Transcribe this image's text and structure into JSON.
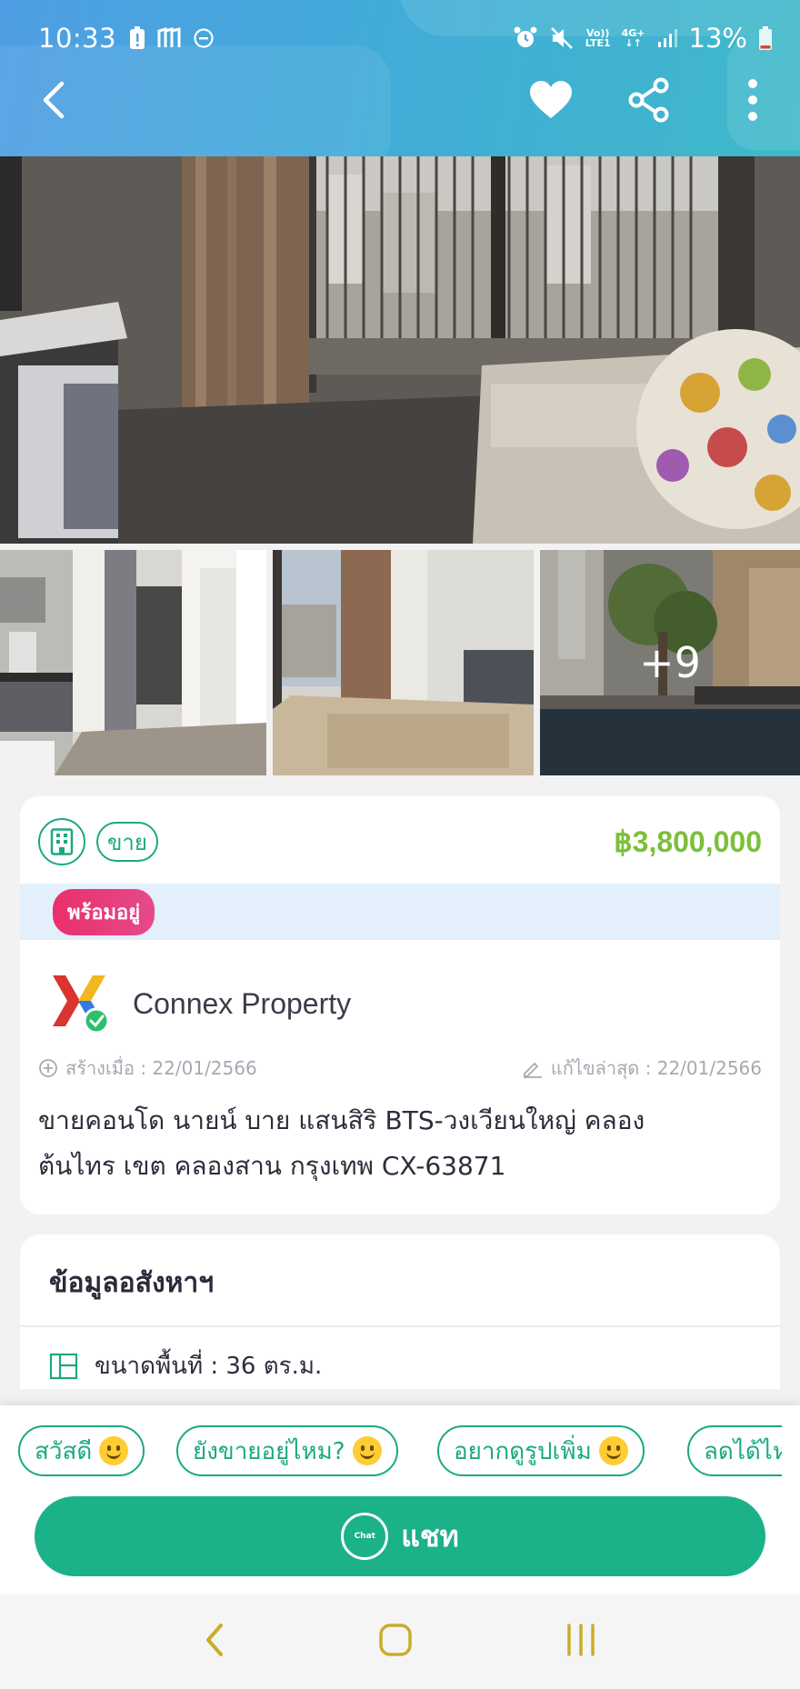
{
  "status_bar": {
    "time": "10:33",
    "net_top": "Vo))",
    "net_bottom": "LTE1",
    "net2_top": "4G+",
    "battery": "13%"
  },
  "gallery": {
    "more_count": "+9"
  },
  "listing": {
    "type_badge": "ขาย",
    "price": "฿3,800,000",
    "status_pill": "พร้อมอยู่",
    "agent_name": "Connex Property",
    "created_label": "สร้างเมื่อ : 22/01/2566",
    "updated_label": "แก้ไขล่าสุด : 22/01/2566",
    "title_line1": "ขายคอนโด  นายน์ บาย แสนสิริ BTS-วงเวียนใหญ่ คลอง",
    "title_line2": "ต้นไทร เขต คลองสาน กรุงเทพ CX-63871"
  },
  "property_info": {
    "section_title": "ข้อมูลอสังหาฯ",
    "area": "ขนาดพื้นที่ : 36 ตร.ม."
  },
  "quick_replies": [
    "สวัสดี",
    "ยังขายอยู่ไหม?",
    "อยากดูรูปเพิ่ม",
    "ลดได้ไหม"
  ],
  "chat_button": {
    "icon_text": "Chat",
    "label": "แชท"
  },
  "colors": {
    "accent": "#1aa981",
    "price": "#7cbf3b",
    "ready_pill": "#e8356f",
    "header_start": "#4f9ee3",
    "header_end": "#3fb9c8"
  },
  "icons": [
    "back-icon",
    "heart-icon",
    "share-icon",
    "more-vert-icon",
    "building-icon",
    "plus-circle-icon",
    "edit-icon",
    "floorplan-icon",
    "chat-icon",
    "nav-back-icon",
    "nav-home-icon",
    "nav-recents-icon"
  ]
}
